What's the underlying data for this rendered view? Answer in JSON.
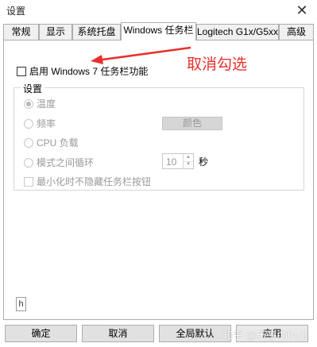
{
  "window": {
    "title": "设置",
    "close_glyph": "✕"
  },
  "tabs": [
    {
      "label": "常规"
    },
    {
      "label": "显示"
    },
    {
      "label": "系统托盘"
    },
    {
      "label": "Windows 任务栏",
      "active": true
    },
    {
      "label": "Logitech G1x/G5xx"
    },
    {
      "label": "高级"
    }
  ],
  "taskbar_panel": {
    "enable_checkbox": {
      "label": "启用 Windows 7 任务栏功能",
      "checked": false
    },
    "settings_group": {
      "title": "设置",
      "options": [
        {
          "label": "温度",
          "selected": true,
          "enabled": false
        },
        {
          "label": "频率",
          "selected": false,
          "enabled": false
        },
        {
          "label": "CPU 负载",
          "selected": false,
          "enabled": false
        },
        {
          "label": "模式之间循环",
          "selected": false,
          "enabled": false
        }
      ],
      "color_button_label": "颜色",
      "cycle_interval": {
        "value": "10",
        "unit": "秒"
      },
      "hide_checkbox": {
        "label": "最小化时不隐藏任务栏按钮",
        "checked": false,
        "enabled": false
      }
    },
    "small_icon_glyph": "h",
    "small_icon_name": "pin-icon"
  },
  "annotation": {
    "text": "取消勾选",
    "color": "#e8312c"
  },
  "footer": {
    "buttons": [
      {
        "label": "确定"
      },
      {
        "label": "取消"
      },
      {
        "label": "全局默认"
      },
      {
        "label": "应用"
      }
    ]
  },
  "watermark": "知乎 @乐享Github"
}
